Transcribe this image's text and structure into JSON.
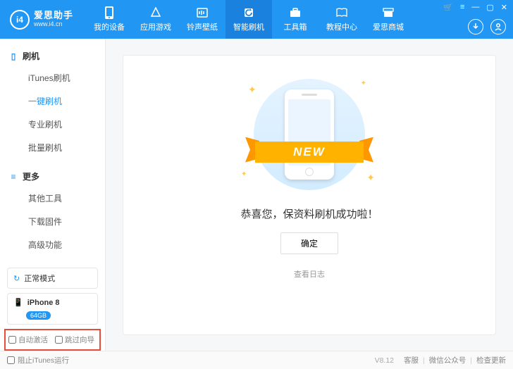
{
  "logo": {
    "mark": "i4",
    "title": "爱思助手",
    "subtitle": "www.i4.cn"
  },
  "nav": [
    {
      "label": "我的设备"
    },
    {
      "label": "应用游戏"
    },
    {
      "label": "铃声壁纸"
    },
    {
      "label": "智能刷机"
    },
    {
      "label": "工具箱"
    },
    {
      "label": "教程中心"
    },
    {
      "label": "爱思商城"
    }
  ],
  "sidebar": {
    "section1": {
      "title": "刷机",
      "items": [
        "iTunes刷机",
        "一键刷机",
        "专业刷机",
        "批量刷机"
      ]
    },
    "section2": {
      "title": "更多",
      "items": [
        "其他工具",
        "下载固件",
        "高级功能"
      ]
    },
    "mode": "正常模式",
    "device": {
      "name": "iPhone 8",
      "storage": "64GB"
    },
    "opts": {
      "autoActivate": "自动激活",
      "skipGuide": "跳过向导"
    }
  },
  "main": {
    "ribbon": "NEW",
    "message": "恭喜您，保资料刷机成功啦！",
    "ok": "确定",
    "viewLog": "查看日志"
  },
  "footer": {
    "blockItunes": "阻止iTunes运行",
    "version": "V8.12",
    "links": [
      "客服",
      "微信公众号",
      "检查更新"
    ]
  }
}
